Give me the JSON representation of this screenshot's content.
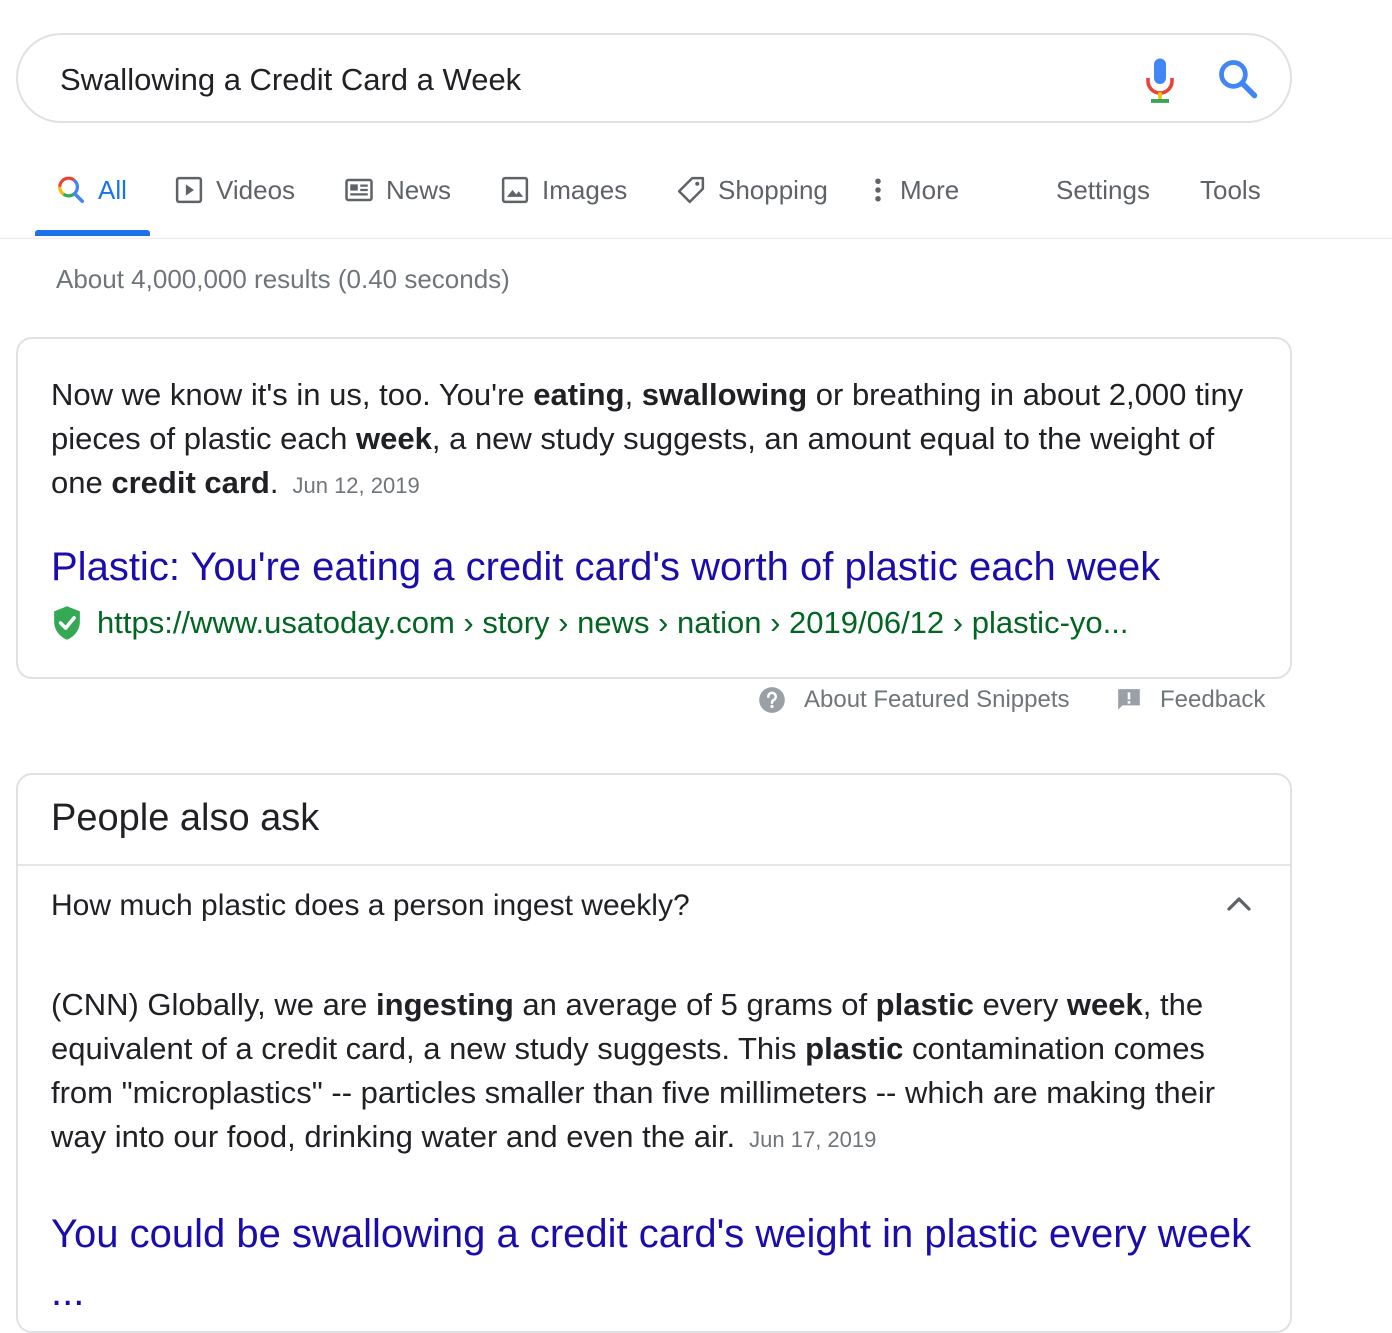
{
  "search": {
    "query": "Swallowing a Credit Card a Week",
    "mic_icon": "mic-icon",
    "search_icon": "search-icon"
  },
  "tabs": [
    {
      "label": "All",
      "icon": "search-icon",
      "active": true
    },
    {
      "label": "Videos",
      "icon": "video-play-icon"
    },
    {
      "label": "News",
      "icon": "newspaper-icon"
    },
    {
      "label": "Images",
      "icon": "image-icon"
    },
    {
      "label": "Shopping",
      "icon": "tag-icon"
    },
    {
      "label": "More",
      "icon": "more-vert-icon"
    }
  ],
  "tools": {
    "settings": "Settings",
    "tools": "Tools"
  },
  "stats": "About 4,000,000 results (0.40 seconds)",
  "featured_snippet": {
    "text_parts": [
      {
        "t": "Now we know it's in us, too. You're ",
        "b": false
      },
      {
        "t": "eating",
        "b": true
      },
      {
        "t": ", ",
        "b": false
      },
      {
        "t": "swallowing",
        "b": true
      },
      {
        "t": " or breathing in about 2,000 tiny pieces of plastic each ",
        "b": false
      },
      {
        "t": "week",
        "b": true
      },
      {
        "t": ", a new study suggests, an amount equal to the weight of one ",
        "b": false
      },
      {
        "t": "credit card",
        "b": true
      },
      {
        "t": ".",
        "b": false
      }
    ],
    "date": "Jun 12, 2019",
    "title": "Plastic: You're eating a credit card's worth of plastic each week",
    "url": "https://www.usatoday.com › story › news › nation › 2019/06/12 › plastic-yo...",
    "about_label": "About Featured Snippets",
    "feedback_label": "Feedback"
  },
  "people_also_ask": {
    "heading": "People also ask",
    "question": "How much plastic does a person ingest weekly?",
    "answer_parts": [
      {
        "t": "(CNN) Globally, we are ",
        "b": false
      },
      {
        "t": "ingesting",
        "b": true
      },
      {
        "t": " an average of 5 grams of ",
        "b": false
      },
      {
        "t": "plastic",
        "b": true
      },
      {
        "t": " every ",
        "b": false
      },
      {
        "t": "week",
        "b": true
      },
      {
        "t": ", the equivalent of a credit card, a new study suggests. This ",
        "b": false
      },
      {
        "t": "plastic",
        "b": true
      },
      {
        "t": " contamination comes from \"microplastics\" -- particles smaller than five millimeters -- which are making their way into our food, drinking water and even the air.",
        "b": false
      }
    ],
    "date": "Jun 17, 2019",
    "link_title": "You could be swallowing a credit card's weight in plastic every week ..."
  },
  "colors": {
    "link": "#1a0dab",
    "url": "#006621",
    "accent": "#1a73e8",
    "secure": "#34a853"
  }
}
